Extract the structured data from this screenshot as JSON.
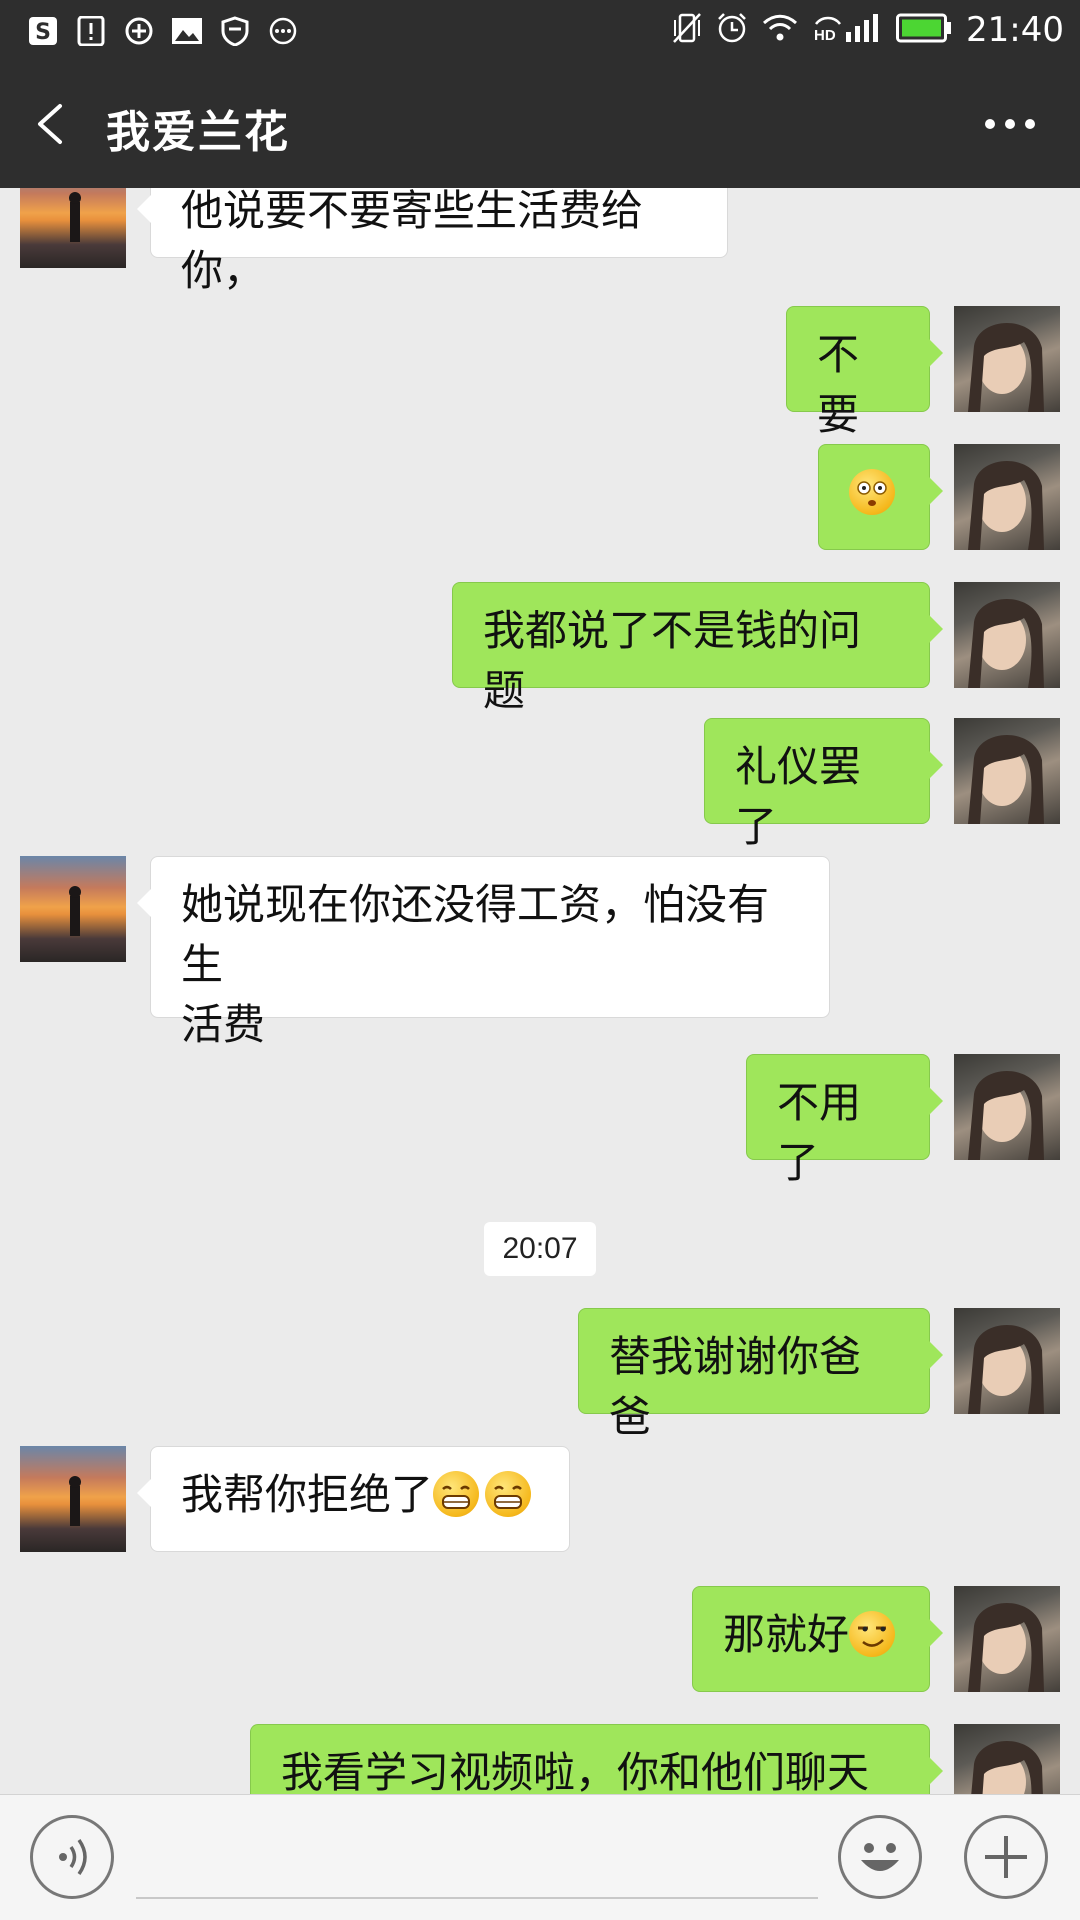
{
  "status_bar": {
    "time": "21:40",
    "left_icons": [
      "s-app-icon",
      "alert-icon",
      "sync-icon",
      "image-icon",
      "shield-icon",
      "more-dots-icon"
    ],
    "right_icons": [
      "vibrate-icon",
      "alarm-icon",
      "wifi-icon",
      "hd-signal-icon",
      "battery-icon"
    ],
    "hd_label": "HD"
  },
  "header": {
    "title": "我爱兰花"
  },
  "messages": [
    {
      "side": "in",
      "text": "他说要不要寄些生活费给你，"
    },
    {
      "side": "out",
      "text": "不要"
    },
    {
      "side": "out",
      "emoji": "flushed-face"
    },
    {
      "side": "out",
      "text": "我都说了不是钱的问题"
    },
    {
      "side": "out",
      "text": "礼仪罢了"
    },
    {
      "side": "in",
      "line1": "她说现在你还没得工资，怕没有生",
      "line2": "活费"
    },
    {
      "side": "out",
      "text": "不用了"
    },
    {
      "side": "out",
      "text": "替我谢谢你爸爸"
    },
    {
      "side": "in",
      "text": "我帮你拒绝了",
      "emoji": [
        "grin-face",
        "grin-face"
      ]
    },
    {
      "side": "out",
      "text": "那就好",
      "emoji": "smirk-face"
    },
    {
      "side": "out",
      "text": "我看学习视频啦，你和他们聊天吧"
    }
  ],
  "timestamp": "20:07",
  "colors": {
    "bar": "#2e2e2e",
    "chat_bg": "#ebebeb",
    "outgoing_bubble": "#9fe65b",
    "incoming_bubble": "#ffffff"
  },
  "input_bar": {
    "voice_icon": "voice-icon",
    "emoji_icon": "emoji-icon",
    "plus_icon": "plus-icon"
  }
}
